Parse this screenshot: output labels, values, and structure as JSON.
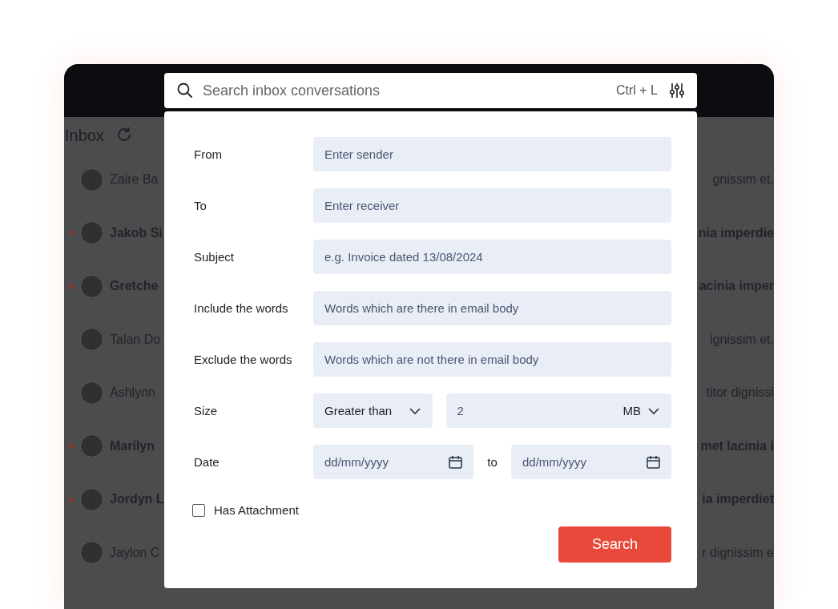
{
  "inbox": {
    "title": "Inbox",
    "conversations": [
      {
        "sender": "Zaire Ba",
        "preview": "gnissim et.",
        "unread": false
      },
      {
        "sender": "Jakob Si",
        "preview": "nia imperdie",
        "unread": true
      },
      {
        "sender": "Gretche",
        "preview": "acinia imper",
        "unread": true
      },
      {
        "sender": "Talan Do",
        "preview": "ignissim et.",
        "unread": false
      },
      {
        "sender": "Ashlynn",
        "preview": "titor dignissi",
        "unread": false
      },
      {
        "sender": "Marilyn",
        "preview": "met lacinia i",
        "unread": true
      },
      {
        "sender": "Jordyn L",
        "preview": "ia imperdiet",
        "unread": true
      },
      {
        "sender": "Jaylon C",
        "preview": "r dignissim e",
        "unread": false
      }
    ]
  },
  "search_bar": {
    "placeholder": "Search inbox conversations",
    "shortcut": "Ctrl + L"
  },
  "filters": {
    "fields": [
      {
        "kind": "text",
        "label": "From",
        "placeholder": "Enter sender"
      },
      {
        "kind": "text",
        "label": "To",
        "placeholder": "Enter receiver"
      },
      {
        "kind": "text",
        "label": "Subject",
        "placeholder": "e.g. Invoice dated 13/08/2024"
      },
      {
        "kind": "text",
        "label": "Include the words",
        "placeholder": "Words which are there in email body"
      },
      {
        "kind": "text",
        "label": "Exclude the words",
        "placeholder": "Words which are not there in email body"
      },
      {
        "kind": "size",
        "label": "Size",
        "comparison": "Greater than",
        "value": "2",
        "unit": "MB"
      },
      {
        "kind": "date",
        "label": "Date",
        "from_placeholder": "dd/mm/yyyy",
        "separator": "to",
        "to_placeholder": "dd/mm/yyyy"
      }
    ],
    "has_attachment": {
      "label": "Has Attachment",
      "checked": false
    },
    "submit": "Search"
  }
}
